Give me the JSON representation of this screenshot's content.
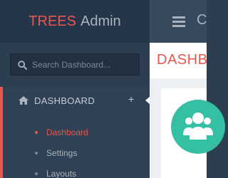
{
  "brand": {
    "part1": "TREES",
    "part2": "Admin"
  },
  "search": {
    "placeholder": "Search Dashboard..."
  },
  "nav": {
    "section_label": "DASHBOARD",
    "items": [
      {
        "label": "Dashboard",
        "active": true
      },
      {
        "label": "Settings",
        "active": false
      },
      {
        "label": "Layouts",
        "active": false
      }
    ]
  },
  "header": {
    "partial_text": "C"
  },
  "page": {
    "title": "DASHB"
  },
  "colors": {
    "accent": "#e8574e",
    "sidebar": "#2c3e50",
    "teal": "#35bfa3"
  },
  "icons": {
    "search": "search-icon",
    "home": "home-icon",
    "plus": "plus-icon",
    "menu": "hamburger-icon",
    "users": "users-icon"
  }
}
